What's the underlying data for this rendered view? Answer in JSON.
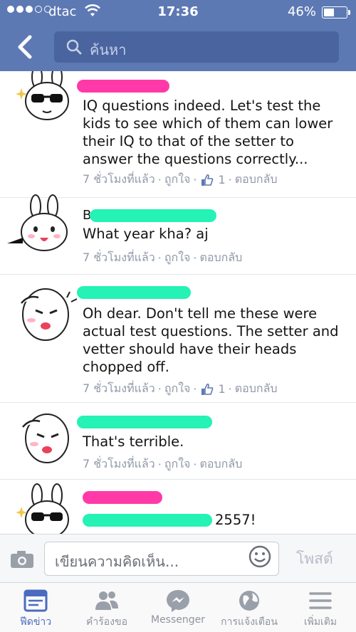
{
  "status_bar": {
    "carrier": "dtac",
    "time": "17:36",
    "battery": "46%",
    "battery_level": 0.46
  },
  "nav": {
    "back_icon": "chevron-left-icon",
    "search_placeholder": "ค้นหา"
  },
  "comments": [
    {
      "name_redacted_color": "#ff3aa8",
      "text": "IQ questions indeed. Let's test the kids to see which of them can lower their IQ to that of the setter to answer the questions correctly...",
      "time": "7 ชั่วโมงที่แล้ว",
      "like": "ถูกใจ",
      "like_count": "1",
      "reply": "ตอบกลับ"
    },
    {
      "name_redacted_color": "#25f2b5",
      "name_initial": "B",
      "text": "What year kha?  aj",
      "time": "7 ชั่วโมงที่แล้ว",
      "like": "ถูกใจ",
      "reply": "ตอบกลับ"
    },
    {
      "name_redacted_color": "#25f2b5",
      "text": "Oh dear. Don't tell me these were actual test questions.  The setter and vetter should have their heads chopped off.",
      "time": "7 ชั่วโมงที่แล้ว",
      "like": "ถูกใจ",
      "like_count": "1",
      "reply": "ตอบกลับ"
    },
    {
      "name_redacted_color": "#25f2b5",
      "text": "That's terrible.",
      "time": "7 ชั่วโมงที่แล้ว",
      "like": "ถูกใจ",
      "reply": "ตอบกลับ"
    },
    {
      "name_redacted_color": "#ff3aa8",
      "text": "2557!"
    }
  ],
  "composer": {
    "placeholder": "เขียนความคิดเห็น...",
    "post_label": "โพสต์"
  },
  "tabs": [
    {
      "label": "ฟีดข่าว",
      "icon": "news-feed-icon",
      "active": true
    },
    {
      "label": "คำร้องขอ",
      "icon": "friend-requests-icon",
      "active": false
    },
    {
      "label": "Messenger",
      "icon": "messenger-icon",
      "active": false
    },
    {
      "label": "การแจ้งเตือน",
      "icon": "globe-notifications-icon",
      "active": false
    },
    {
      "label": "เพิ่มเติม",
      "icon": "menu-icon",
      "active": false
    }
  ],
  "colors": {
    "nav_blue": "#5d79b4",
    "active_tab": "#4a6bbf",
    "meta_gray": "#9099a8"
  }
}
